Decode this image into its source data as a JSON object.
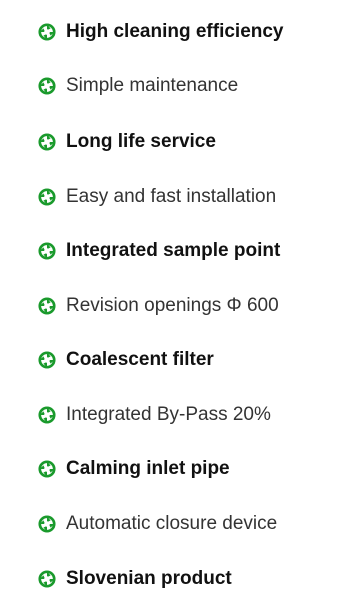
{
  "features": {
    "icon": "recycling-icon",
    "icon_color": "#1a9a2c",
    "items": [
      {
        "label": "High cleaning efficiency",
        "bold": true
      },
      {
        "label": "Simple maintenance",
        "bold": false
      },
      {
        "label": "Long life service",
        "bold": true
      },
      {
        "label": "Easy and fast installation",
        "bold": false
      },
      {
        "label": "Integrated sample point",
        "bold": true
      },
      {
        "label": "Revision openings Φ 600",
        "bold": false
      },
      {
        "label": "Coalescent filter",
        "bold": true
      },
      {
        "label": "Integrated By-Pass 20%",
        "bold": false
      },
      {
        "label": "Calming inlet pipe",
        "bold": true
      },
      {
        "label": "Automatic closure device",
        "bold": false
      },
      {
        "label": "Slovenian product",
        "bold": true
      }
    ]
  }
}
